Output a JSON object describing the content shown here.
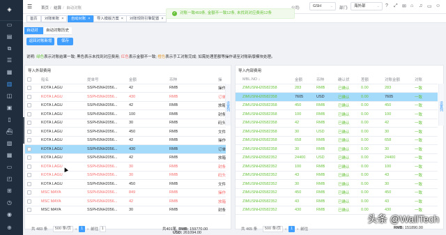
{
  "breadcrumb": [
    "首页",
    "结算",
    "自动对账"
  ],
  "notice": "对账一致459条, 金额不一致12条, 未找到对应费用12条",
  "topbar": {
    "company_label": "公司:",
    "company_value": "GSH",
    "dept_label": "部门:",
    "dept_value": "海外部"
  },
  "tabs": [
    "首页",
    "对账新账",
    "自动对账",
    "导入模版方案",
    "对账规则引擎配置"
  ],
  "subtabs": [
    "自动对账",
    "自动对账历史"
  ],
  "buttons": {
    "back": "返回对账新增",
    "save": "保存"
  },
  "description": {
    "prefix": "说明: ",
    "green": "绿色",
    "p1": "表示对账结果一致; 黑色表示未找到对应费用; ",
    "red": "红色",
    "p2": "表示金额不一致; ",
    "orange": "橙色",
    "p3": "表示手工对账完成; 如需处理差额等操作请至对账新版模块处理。"
  },
  "left_panel": {
    "title": "导入外部费用",
    "columns": [
      "船名",
      "提单号",
      "金额",
      "币种",
      "操"
    ],
    "side_label": "设置列",
    "rows": [
      {
        "ship": "KOTA LAGU",
        "bl": "SSPHSNH2056...",
        "amount": "42",
        "currency": "RMB",
        "op": "操作",
        "status": "normal"
      },
      {
        "ship": "KOTA LAGU",
        "bl": "SSPHSNH2056...",
        "amount": "430",
        "currency": "RMB",
        "op": "订单",
        "status": "red"
      },
      {
        "ship": "KOTA LAGU",
        "bl": "SSPHSNH2056...",
        "amount": "42",
        "currency": "RMB",
        "op": "放箱",
        "status": "normal"
      },
      {
        "ship": "KOTA LAGU",
        "bl": "SSPHSNH2056...",
        "amount": "100",
        "currency": "RMB",
        "op": "封条",
        "status": "normal"
      },
      {
        "ship": "KOTA LAGU",
        "bl": "SSPHSNH2056...",
        "amount": "30",
        "currency": "RMB",
        "op": "码头",
        "status": "normal"
      },
      {
        "ship": "KOTA LAGU",
        "bl": "SSPHSNH2056...",
        "amount": "450",
        "currency": "RMB",
        "op": "文件",
        "status": "normal"
      },
      {
        "ship": "KOTA LAGU",
        "bl": "SSPHSNH2056...",
        "amount": "42",
        "currency": "RMB",
        "op": "操作",
        "status": "normal"
      },
      {
        "ship": "KOTA LAGU",
        "bl": "SSPHSNH2056...",
        "amount": "430",
        "currency": "RMB",
        "op": "订单",
        "status": "selected"
      },
      {
        "ship": "KOTA LAGU",
        "bl": "SSPHSNH2056...",
        "amount": "42",
        "currency": "RMB",
        "op": "放箱",
        "status": "normal"
      },
      {
        "ship": "KOTA LAGU",
        "bl": "SSPHSNH2056...",
        "amount": "30",
        "currency": "RMB",
        "op": "封条",
        "status": "red"
      },
      {
        "ship": "KOTA LAGU",
        "bl": "SSPHSNH2056...",
        "amount": "30",
        "currency": "RMB",
        "op": "码头",
        "status": "red"
      },
      {
        "ship": "KOTA LAGU",
        "bl": "SSPHSNH2056...",
        "amount": "450",
        "currency": "RMB",
        "op": "文件",
        "status": "normal"
      },
      {
        "ship": "MSC MAYA",
        "bl": "SSPHSNH2056...",
        "amount": "849",
        "currency": "RMB",
        "op": "操作",
        "status": "red"
      },
      {
        "ship": "MSC MAYA",
        "bl": "SSPHSNH2056...",
        "amount": "42",
        "currency": "RMB",
        "op": "放箱",
        "status": "red"
      },
      {
        "ship": "MSC MAYA",
        "bl": "SSPHSNH2056...",
        "amount": "30",
        "currency": "RMB",
        "op": "封条",
        "status": "normal"
      }
    ],
    "pager": {
      "total": "共 483 条",
      "size": "500",
      "size_unit": "条/页",
      "page": "1",
      "goto": "前往",
      "goto_page": "1"
    },
    "summary_count": "共401笔,",
    "summary_rmb_label": "RMB:",
    "summary_rmb": "159770.00",
    "summary_usd_label": "USD:",
    "summary_usd": "261094.00"
  },
  "right_panel": {
    "title": "导入内部费用",
    "columns": [
      "MBL.NO",
      "金额",
      "币种",
      "确认状",
      "差额",
      "对账金额",
      "对账"
    ],
    "side_label": "设置列",
    "rows": [
      {
        "mbl": "ZIMUSNH20582358",
        "amount": "283",
        "currency": "RMB",
        "confirm": "已确认",
        "diff": "0.00",
        "recon": "283",
        "result": "一致",
        "status": "normal"
      },
      {
        "mbl": "ZIMUSNH20582358",
        "amount": "7605",
        "currency": "USD",
        "confirm": "已确认",
        "diff": "0.00",
        "recon": "7605",
        "result": "一致",
        "status": "selected"
      },
      {
        "mbl": "ZIMUSNH20582358",
        "amount": "450",
        "currency": "RMB",
        "confirm": "已确认",
        "diff": "0.00",
        "recon": "450",
        "result": "一致",
        "status": "normal"
      },
      {
        "mbl": "ZIMUSNH20582358",
        "amount": "100",
        "currency": "RMB",
        "confirm": "已确认",
        "diff": "0.00",
        "recon": "100",
        "result": "一致",
        "status": "normal"
      },
      {
        "mbl": "ZIMUSNH20582358",
        "amount": "42",
        "currency": "RMB",
        "confirm": "已确认",
        "diff": "0.00",
        "recon": "42",
        "result": "一致",
        "status": "normal"
      },
      {
        "mbl": "ZIMUSNH20582358",
        "amount": "30",
        "currency": "USD",
        "confirm": "已确认",
        "diff": "0.00",
        "recon": "30",
        "result": "一致",
        "status": "normal"
      },
      {
        "mbl": "ZIMUSNH20582358",
        "amount": "658",
        "currency": "RMB",
        "confirm": "已确认",
        "diff": "0.00",
        "recon": "658",
        "result": "一致",
        "status": "normal"
      },
      {
        "mbl": "ZIMUSNH20582358",
        "amount": "30",
        "currency": "RMB",
        "confirm": "已确认",
        "diff": "0.00",
        "recon": "30",
        "result": "一致",
        "status": "normal"
      },
      {
        "mbl": "ZIMUSNH20582352",
        "amount": "24400",
        "currency": "USD",
        "confirm": "已确认",
        "diff": "0.00",
        "recon": "24400",
        "result": "一致",
        "status": "normal"
      },
      {
        "mbl": "ZIMUSNH20582352",
        "amount": "100",
        "currency": "RMB",
        "confirm": "已确认",
        "diff": "0.00",
        "recon": "100",
        "result": "一致",
        "status": "normal"
      },
      {
        "mbl": "ZIMUSNH20582352",
        "amount": "43",
        "currency": "RMB",
        "confirm": "已确认",
        "diff": "0.00",
        "recon": "43",
        "result": "一致",
        "status": "normal"
      },
      {
        "mbl": "ZIMUSNH20582352",
        "amount": "30",
        "currency": "RMB",
        "confirm": "已确认",
        "diff": "0.00",
        "recon": "30",
        "result": "一致",
        "status": "normal"
      },
      {
        "mbl": "ZIMUSNH20582352",
        "amount": "450",
        "currency": "RMB",
        "confirm": "已确认",
        "diff": "0.00",
        "recon": "450",
        "result": "一致",
        "status": "normal"
      },
      {
        "mbl": "ZIMUSNH20582352",
        "amount": "43",
        "currency": "RMB",
        "confirm": "已确认",
        "diff": "0.00",
        "recon": "43",
        "result": "一致",
        "status": "normal"
      },
      {
        "mbl": "ZIMUSNH20582352",
        "amount": "430",
        "currency": "RMB",
        "confirm": "已确认",
        "diff": "0.00",
        "recon": "430",
        "result": "一致",
        "status": "normal"
      }
    ],
    "pager": {
      "total": "共 465 条",
      "size": "500",
      "size_unit": "条/页",
      "page": "1",
      "goto": "前往"
    },
    "summary_label": "RMB:",
    "summary_rmb": "151890.00"
  },
  "watermark": "头条 @WallTech",
  "colors": {
    "primary": "#409eff",
    "green": "#67c23a",
    "red": "#f56c6c",
    "orange": "#e6a23c",
    "sidebar": "#1f2d3d",
    "selected_row": "#a4dafa"
  }
}
